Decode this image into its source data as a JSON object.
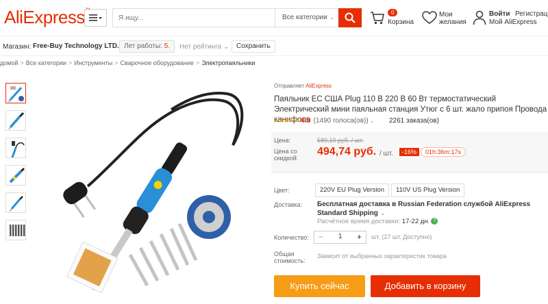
{
  "header": {
    "logo": "AliExpress",
    "menu_icon": "hamburger-icon",
    "search_placeholder": "Я ищу...",
    "category": "Все категории",
    "cart_count": "0",
    "cart_label": "Корзина",
    "wishlist_label": "Мои желания",
    "login": "Войти",
    "register": "Регистрация",
    "my_ae": "Мой AliExpress"
  },
  "store": {
    "label": "Магазин:",
    "name": "Free-Buy Technology LTD.",
    "years_label": "Лет работы:",
    "years_value": "5",
    "rating": "Нет рейтинга",
    "save": "Сохранить"
  },
  "breadcrumb": [
    "домой",
    "Все категории",
    "Инструменты",
    "Сварочное оборудование",
    "Электропаяльники"
  ],
  "product": {
    "ships_from_label": "Отправляет",
    "ships_from": "AliExpress",
    "title": "Паяльник ЕС США Plug 110 В 220 В 60 Вт термостатический Электрический мини паяльная станция Утюг с 6 шт. жало припоя Провода канифоль",
    "score": "4.9",
    "votes": "(1490 голоса(ов))",
    "orders": "2261 заказа(ов)",
    "price_label": "Цена:",
    "old_price": "589,10 руб. / шт.",
    "discount_label": "Цена со скидкой:",
    "new_price": "494,74 руб.",
    "per_unit": "/ шт.",
    "discount": "-16%",
    "timer": "01h:36m:17s",
    "color_label": "Цвет:",
    "colors": [
      "220V EU Plug Version",
      "110V US Plug Version"
    ],
    "delivery_label": "Доставка:",
    "delivery": "Бесплатная доставка в Russian Federation службой AliExpress Standard Shipping",
    "delivery_time_label": "Расчётное время доставки:",
    "delivery_time": "17-22 дн.",
    "qty_label": "Количество:",
    "qty_minus": "−",
    "qty": "1",
    "qty_plus": "+",
    "qty_note": "шт. (27 шт. Доступно)",
    "total_label": "Общая стоимость:",
    "total_note": "Зависит от выбранных характеристик товара",
    "buy_now": "Купить сейчас",
    "add_to_cart": "Добавить в корзину"
  },
  "colors": {
    "accent": "#e62e04",
    "buy": "#f79c17",
    "star": "#f5a623"
  }
}
